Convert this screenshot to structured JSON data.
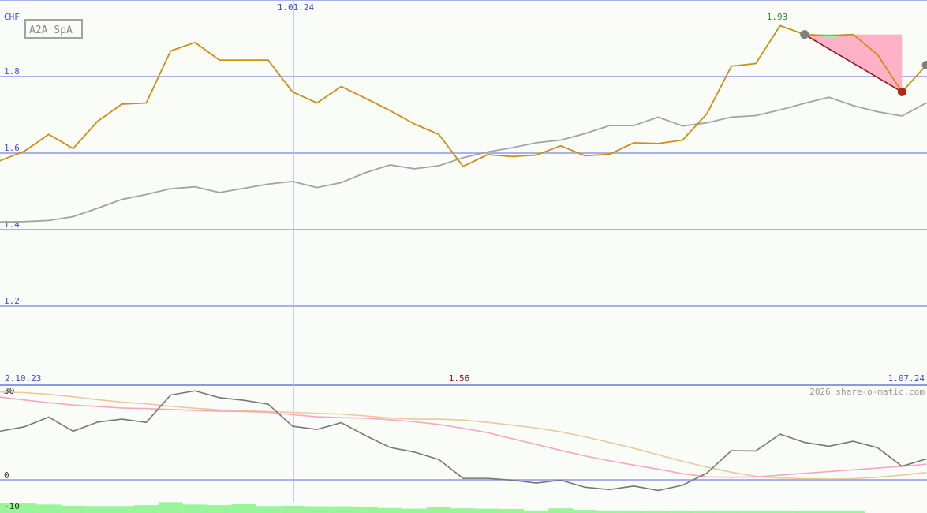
{
  "colors": {
    "background": "#fafcf7",
    "grid": "#8d97ea",
    "axis_text": "#3a4fd0",
    "price": "#cc8f14",
    "price_ma": "#a3a3a3",
    "osc": "#777777",
    "osc_signal": "#f3a8c0",
    "osc_slow": "#e8c99a",
    "volume": "#98f59a",
    "label_high": "#2a8a2a",
    "label_low": "#8a1010",
    "pattern_fill": "#ffb1c8",
    "pattern_line": "#8b1a1a",
    "marker_grey": "#808080",
    "marker_red": "#b02a16"
  },
  "header": {
    "title": "A2A SpA",
    "currency": "CHF",
    "watermark": "2026 share-o-matic.com"
  },
  "chart_data": [
    {
      "type": "line",
      "title": "A2A SpA",
      "ylabel": "CHF",
      "ylim": [
        1.0,
        2.0
      ],
      "yticks": [
        1.2,
        1.4,
        1.6,
        1.8
      ],
      "ytick_labels": [
        "1.2",
        "1.4",
        "1.6",
        "1.8"
      ],
      "x_labels": [
        "2.10.23",
        "1.01.24",
        "1.07.24"
      ],
      "annotations": {
        "high": "1.93",
        "low": "1.56"
      },
      "series": [
        {
          "key": "price",
          "values": [
            1.58,
            1.605,
            1.649,
            1.612,
            1.683,
            1.728,
            1.731,
            1.867,
            1.889,
            1.843,
            1.843,
            1.843,
            1.76,
            1.731,
            1.774,
            1.743,
            1.711,
            1.676,
            1.649,
            1.565,
            1.596,
            1.591,
            1.595,
            1.619,
            1.593,
            1.597,
            1.627,
            1.625,
            1.634,
            1.703,
            1.827,
            1.834,
            1.933,
            1.91,
            1.907,
            1.91,
            1.857,
            1.76,
            1.83
          ]
        },
        {
          "key": "price_ma",
          "values": [
            1.42,
            1.421,
            1.424,
            1.434,
            1.456,
            1.479,
            1.492,
            1.507,
            1.512,
            1.497,
            1.508,
            1.519,
            1.526,
            1.51,
            1.523,
            1.549,
            1.569,
            1.559,
            1.567,
            1.588,
            1.603,
            1.614,
            1.627,
            1.634,
            1.651,
            1.672,
            1.672,
            1.694,
            1.671,
            1.679,
            1.694,
            1.698,
            1.713,
            1.73,
            1.746,
            1.724,
            1.708,
            1.697,
            1.731
          ]
        }
      ]
    },
    {
      "type": "line",
      "ylim": [
        -10,
        30
      ],
      "yticks": [
        0,
        30
      ],
      "ytick_labels": [
        "0",
        "30",
        "-10"
      ],
      "series": [
        {
          "key": "osc",
          "values": [
            16.5,
            18.0,
            21.3,
            16.5,
            19.6,
            20.6,
            19.5,
            28.8,
            30.2,
            27.9,
            27.0,
            25.7,
            18.2,
            17.1,
            19.4,
            15.0,
            11.0,
            9.4,
            6.9,
            0.5,
            0.5,
            -0.1,
            -1.1,
            -0.1,
            -2.5,
            -3.3,
            -2.1,
            -3.6,
            -1.8,
            2.3,
            9.9,
            9.8,
            15.5,
            12.7,
            11.4,
            13.1,
            10.9,
            4.6,
            7.1
          ]
        },
        {
          "key": "osc_signal",
          "values": [
            28.1,
            27.1,
            26.2,
            25.4,
            24.9,
            24.4,
            24.2,
            23.9,
            23.6,
            23.3,
            23.2,
            22.9,
            22.1,
            21.4,
            21.1,
            20.9,
            20.4,
            19.7,
            18.8,
            17.5,
            16.0,
            14.0,
            12.0,
            10.0,
            8.1,
            6.5,
            5.0,
            3.6,
            2.1,
            1.0,
            0.9,
            1.0,
            1.6,
            2.2,
            2.8,
            3.4,
            4.0,
            4.6,
            5.3
          ]
        },
        {
          "key": "osc_slow",
          "values": [
            29.8,
            29.6,
            29.0,
            28.2,
            27.2,
            26.4,
            25.8,
            25.0,
            24.3,
            23.8,
            23.5,
            23.2,
            22.9,
            22.6,
            22.3,
            21.7,
            21.0,
            20.6,
            20.6,
            20.3,
            19.5,
            18.6,
            17.6,
            16.3,
            14.6,
            12.7,
            10.7,
            8.5,
            6.3,
            4.3,
            2.6,
            1.2,
            0.6,
            0.4,
            0.3,
            0.4,
            0.9,
            1.6,
            2.5
          ]
        },
        {
          "key": "volume",
          "values": [
            -7.8,
            -7.8,
            -8.4,
            -8.8,
            -8.9,
            -8.9,
            -8.6,
            -7.6,
            -8.4,
            -8.6,
            -8.2,
            -8.9,
            -8.8,
            -9.0,
            -9.0,
            -9.1,
            -9.6,
            -9.8,
            -9.3,
            -9.7,
            -9.8,
            -9.9,
            -10.4,
            -9.7,
            -10.2,
            -10.4,
            -10.4,
            -10.4,
            -10.4,
            -10.4,
            -10.4,
            -10.4,
            -10.4,
            -10.4,
            -10.4,
            -10.4,
            0,
            0,
            0
          ]
        }
      ]
    }
  ]
}
